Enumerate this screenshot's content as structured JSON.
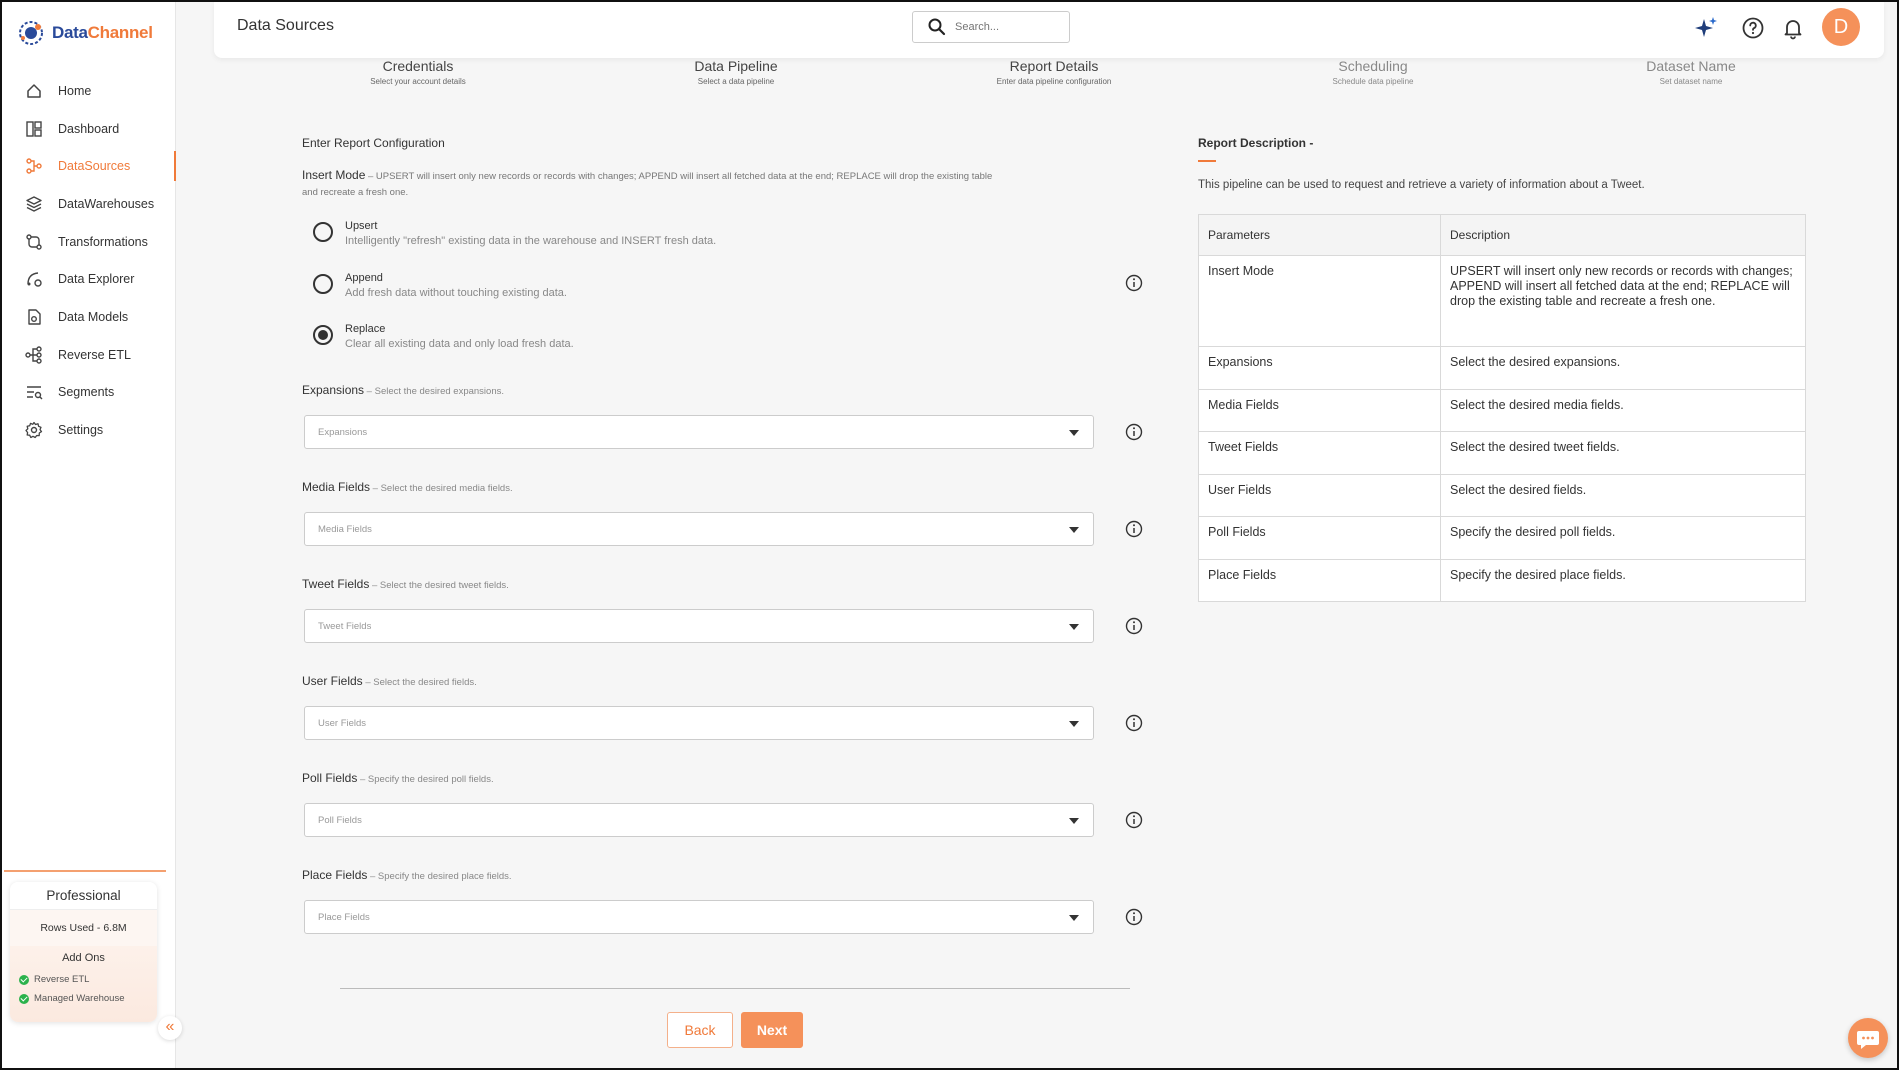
{
  "brand": {
    "part1": "Data",
    "part2": "Channel"
  },
  "sidebar": {
    "items": [
      {
        "label": "Home",
        "icon": "home-icon"
      },
      {
        "label": "Dashboard",
        "icon": "dashboard-icon"
      },
      {
        "label": "DataSources",
        "icon": "datasources-icon",
        "active": true
      },
      {
        "label": "DataWarehouses",
        "icon": "warehouse-icon"
      },
      {
        "label": "Transformations",
        "icon": "transformations-icon"
      },
      {
        "label": "Data Explorer",
        "icon": "explorer-icon"
      },
      {
        "label": "Data Models",
        "icon": "models-icon"
      },
      {
        "label": "Reverse ETL",
        "icon": "reverse-etl-icon"
      },
      {
        "label": "Segments",
        "icon": "segments-icon"
      },
      {
        "label": "Settings",
        "icon": "gear-icon"
      }
    ],
    "plan": {
      "name": "Professional",
      "rows_used": "Rows Used - 6.8M",
      "addons_title": "Add Ons",
      "addons": [
        "Reverse ETL",
        "Managed Warehouse"
      ]
    }
  },
  "header": {
    "title": "Data Sources",
    "search_placeholder": "Search...",
    "avatar_initial": "D"
  },
  "steps": [
    {
      "title": "Credentials",
      "sub": "Select your account details"
    },
    {
      "title": "Data Pipeline",
      "sub": "Select a data pipeline"
    },
    {
      "title": "Report Details",
      "sub": "Enter data pipeline configuration"
    },
    {
      "title": "Scheduling",
      "sub": "Schedule data pipeline"
    },
    {
      "title": "Dataset Name",
      "sub": "Set dataset name"
    }
  ],
  "form": {
    "title": "Enter Report Configuration",
    "insert_mode": {
      "label": "Insert Mode",
      "hint": " – UPSERT will insert only new records or records with changes; APPEND will insert all fetched data at the end; REPLACE will drop the existing table and recreate a fresh one.",
      "options": [
        {
          "title": "Upsert",
          "desc": "Intelligently \"refresh\" existing data in the warehouse and INSERT fresh data.",
          "checked": false
        },
        {
          "title": "Append",
          "desc": "Add fresh data without touching existing data.",
          "checked": false
        },
        {
          "title": "Replace",
          "desc": "Clear all existing data and only load fresh data.",
          "checked": true
        }
      ]
    },
    "fields": [
      {
        "label": "Expansions",
        "hint": " – Select the desired expansions.",
        "placeholder": "Expansions"
      },
      {
        "label": "Media Fields",
        "hint": " – Select the desired media fields.",
        "placeholder": "Media Fields"
      },
      {
        "label": "Tweet Fields",
        "hint": " – Select the desired tweet fields.",
        "placeholder": "Tweet Fields"
      },
      {
        "label": "User Fields",
        "hint": " – Select the desired fields.",
        "placeholder": "User Fields"
      },
      {
        "label": "Poll Fields",
        "hint": " – Specify the desired poll fields.",
        "placeholder": "Poll Fields"
      },
      {
        "label": "Place Fields",
        "hint": " – Specify the desired place fields.",
        "placeholder": "Place Fields"
      }
    ],
    "back_label": "Back",
    "next_label": "Next"
  },
  "report_description": {
    "title": "Report Description -",
    "text": "This pipeline can be used to request and retrieve a variety of information about a Tweet.",
    "columns": [
      "Parameters",
      "Description"
    ],
    "rows": [
      [
        "Insert Mode",
        "UPSERT will insert only new records or records with changes; APPEND will insert all fetched data at the end; REPLACE will drop the existing table and recreate a fresh one."
      ],
      [
        "Expansions",
        "Select the desired expansions."
      ],
      [
        "Media Fields",
        "Select the desired media fields."
      ],
      [
        "Tweet Fields",
        "Select the desired tweet fields."
      ],
      [
        "User Fields",
        "Select the desired fields."
      ],
      [
        "Poll Fields",
        "Specify the desired poll fields."
      ],
      [
        "Place Fields",
        "Specify the desired place fields."
      ]
    ]
  },
  "colors": {
    "accent": "#f07a3a",
    "brand_blue": "#2a4a9a",
    "avatar": "#f5915a"
  }
}
